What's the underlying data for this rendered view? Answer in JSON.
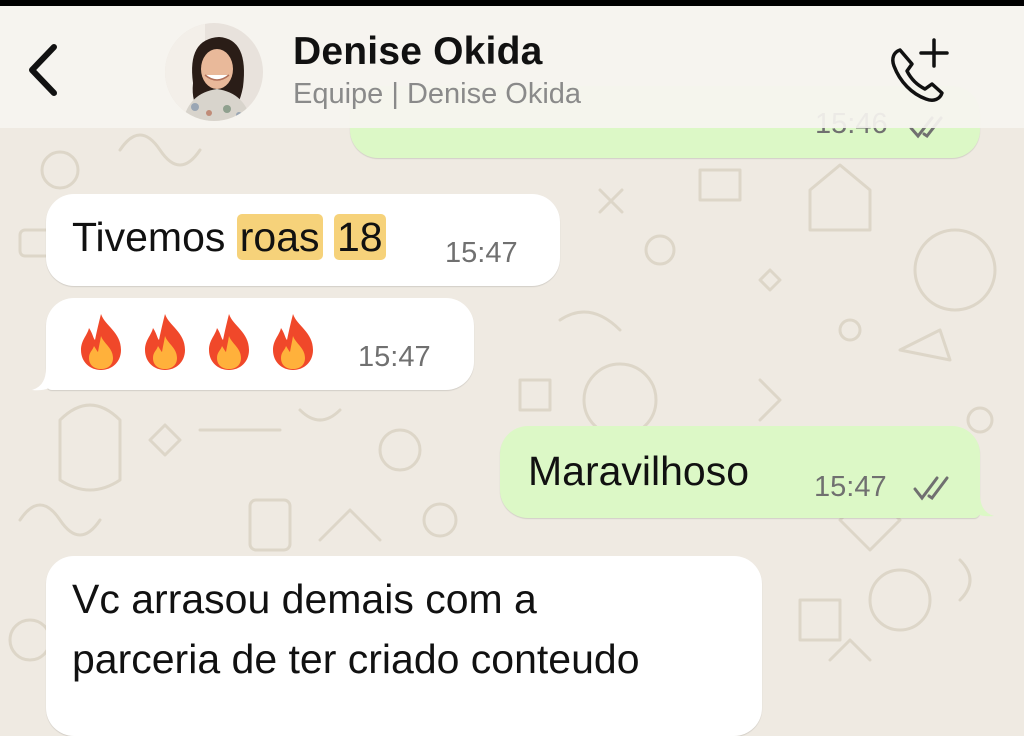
{
  "header": {
    "contact_name": "Denise Okida",
    "subtitle": "Equipe | Denise Okida",
    "back_icon": "chevron-left-icon",
    "call_icon": "phone-add-icon"
  },
  "messages": [
    {
      "direction": "outgoing",
      "time": "15:46",
      "status": "read"
    },
    {
      "direction": "incoming",
      "text_plain": "Tivemos ",
      "highlight_1": "roas",
      "highlight_2": "18",
      "time": "15:47"
    },
    {
      "direction": "incoming",
      "emoji": "🔥🔥🔥🔥",
      "time": "15:47"
    },
    {
      "direction": "outgoing",
      "text": "Maravilhoso",
      "time": "15:47",
      "status": "read"
    },
    {
      "direction": "incoming",
      "line1": "Vc arrasou demais com a",
      "line2": "parceria de ter criado conteudo"
    }
  ],
  "colors": {
    "background": "#efeae2",
    "incoming_bubble": "#ffffff",
    "outgoing_bubble": "#dcf8c6",
    "highlight": "#f6d27a",
    "tick_color": "#707070"
  }
}
